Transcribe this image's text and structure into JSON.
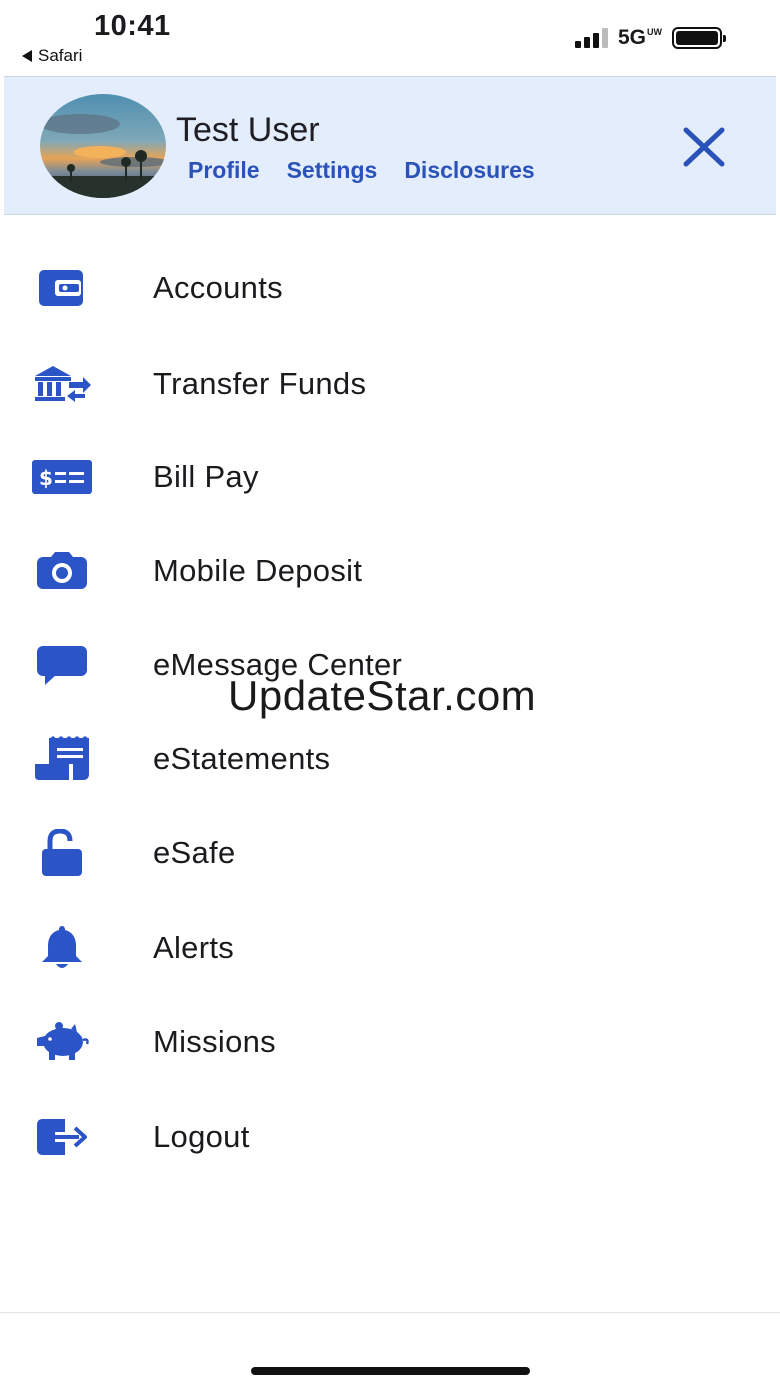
{
  "status_bar": {
    "time": "10:41",
    "back_app": "Safari",
    "network": "5G",
    "network_suffix": "UW"
  },
  "header": {
    "user_name": "Test User",
    "links": [
      "Profile",
      "Settings",
      "Disclosures"
    ],
    "close_icon": "close-icon"
  },
  "menu": {
    "items": [
      {
        "label": "Accounts",
        "icon": "wallet-icon"
      },
      {
        "label": "Transfer Funds",
        "icon": "bank-transfer-icon"
      },
      {
        "label": "Bill Pay",
        "icon": "bill-check-icon"
      },
      {
        "label": "Mobile Deposit",
        "icon": "camera-icon"
      },
      {
        "label": "eMessage Center",
        "icon": "chat-bubble-icon"
      },
      {
        "label": "eStatements",
        "icon": "statement-scroll-icon"
      },
      {
        "label": "eSafe",
        "icon": "unlocked-padlock-icon"
      },
      {
        "label": "Alerts",
        "icon": "bell-icon"
      },
      {
        "label": "Missions",
        "icon": "piggy-bank-icon"
      },
      {
        "label": "Logout",
        "icon": "logout-icon"
      }
    ]
  },
  "watermark": "UpdateStar.com",
  "colors": {
    "accent": "#2a52b8",
    "icon": "#2b54c6",
    "header_bg": "#e3edfb"
  }
}
